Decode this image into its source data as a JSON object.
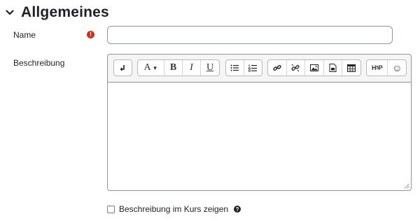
{
  "section": {
    "title": "Allgemeines",
    "icon": "chevron-down-icon"
  },
  "fields": {
    "name": {
      "label": "Name",
      "value": "",
      "placeholder": "",
      "required": true,
      "required_icon": "!"
    },
    "description": {
      "label": "Beschreibung",
      "value": ""
    }
  },
  "toolbar": {
    "groups": [
      {
        "items": [
          {
            "name": "toggle-toolbar-icon",
            "glyph": ""
          }
        ]
      },
      {
        "items": [
          {
            "name": "font-style-icon",
            "glyph": "A▾"
          },
          {
            "name": "bold-icon",
            "glyph": "B"
          },
          {
            "name": "italic-icon",
            "glyph": "I"
          },
          {
            "name": "underline-icon",
            "glyph": "U"
          }
        ]
      },
      {
        "items": [
          {
            "name": "unordered-list-icon"
          },
          {
            "name": "ordered-list-icon"
          }
        ]
      },
      {
        "items": [
          {
            "name": "link-icon"
          },
          {
            "name": "unlink-icon"
          },
          {
            "name": "image-icon"
          },
          {
            "name": "media-icon"
          },
          {
            "name": "table-icon"
          }
        ]
      },
      {
        "items": [
          {
            "name": "h5p-icon",
            "glyph": "H5P"
          },
          {
            "name": "emoji-icon",
            "glyph": "☺"
          }
        ]
      }
    ]
  },
  "checkbox": {
    "label": "Beschreibung im Kurs zeigen",
    "checked": false,
    "help_icon": "?"
  },
  "colors": {
    "required": "#ca3120",
    "border": "#8f959e",
    "toolbar_bg": "#f5f5f5"
  }
}
